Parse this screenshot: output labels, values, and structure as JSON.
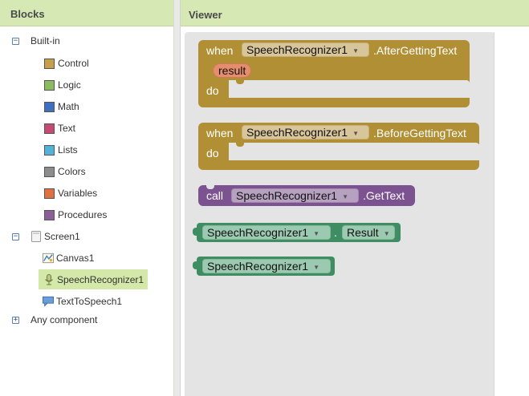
{
  "blocks_panel": {
    "title": "Blocks",
    "builtin": {
      "label": "Built-in",
      "toggle": "−",
      "items": [
        {
          "label": "Control",
          "color": "#c59f4a"
        },
        {
          "label": "Logic",
          "color": "#8cba60"
        },
        {
          "label": "Math",
          "color": "#3e6fc0"
        },
        {
          "label": "Text",
          "color": "#c54a74"
        },
        {
          "label": "Lists",
          "color": "#52b3d8"
        },
        {
          "label": "Colors",
          "color": "#8c8c8c"
        },
        {
          "label": "Variables",
          "color": "#e07040"
        },
        {
          "label": "Procedures",
          "color": "#8a6098"
        }
      ]
    },
    "screen": {
      "label": "Screen1",
      "toggle": "−",
      "items": [
        {
          "label": "Canvas1",
          "icon": "canvas-icon"
        },
        {
          "label": "SpeechRecognizer1",
          "icon": "microphone-icon",
          "selected": true
        },
        {
          "label": "TextToSpeech1",
          "icon": "speaker-icon"
        }
      ]
    },
    "any_component": {
      "label": "Any component",
      "toggle": "+"
    }
  },
  "viewer": {
    "title": "Viewer",
    "event_after": {
      "when": "when",
      "component": "SpeechRecognizer1",
      "event": ".AfterGettingText",
      "param": "result",
      "do": "do"
    },
    "event_before": {
      "when": "when",
      "component": "SpeechRecognizer1",
      "event": ".BeforeGettingText",
      "do": "do"
    },
    "call_block": {
      "call": "call",
      "component": "SpeechRecognizer1",
      "method": ".GetText"
    },
    "property_getter": {
      "component": "SpeechRecognizer1",
      "dot": ".",
      "property": "Result"
    },
    "component_block": {
      "component": "SpeechRecognizer1"
    },
    "dropdown_arrow": "▼"
  }
}
